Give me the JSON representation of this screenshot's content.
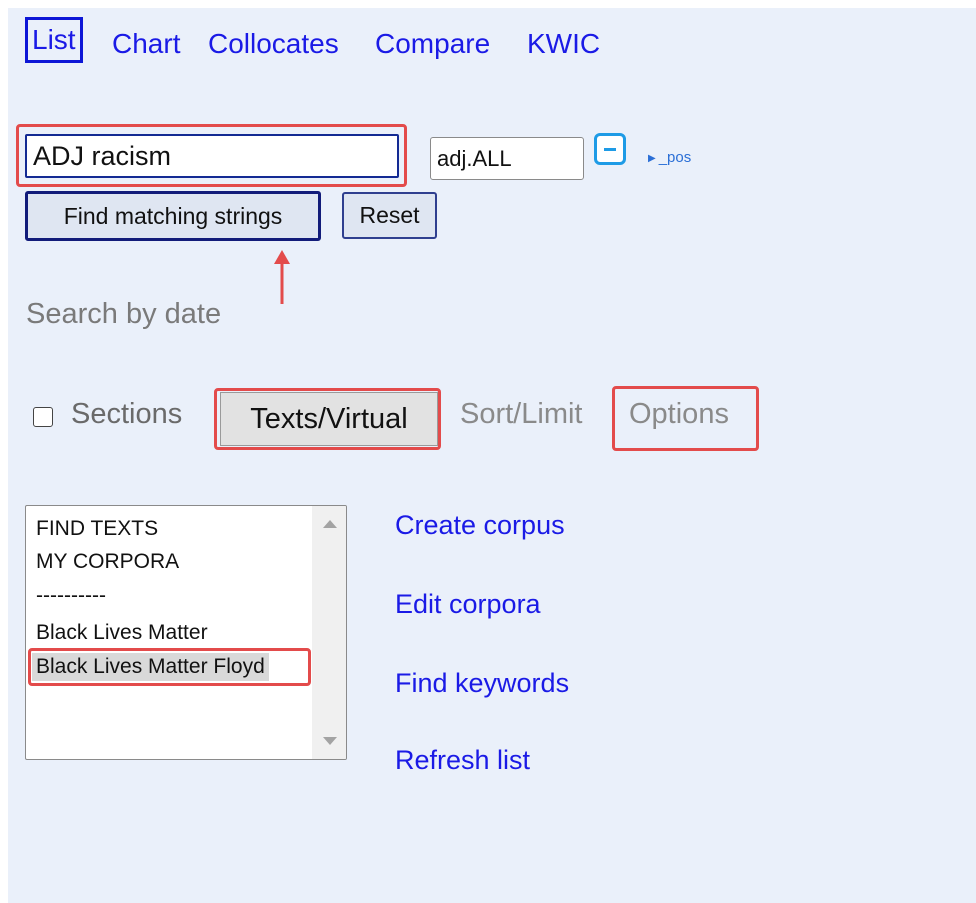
{
  "nav": {
    "tabs": [
      {
        "label": "List",
        "active": true
      },
      {
        "label": "Chart"
      },
      {
        "label": "Collocates"
      },
      {
        "label": "Compare"
      },
      {
        "label": "KWIC"
      }
    ]
  },
  "search": {
    "word_value": "ADJ racism",
    "pos_value": "adj.ALL",
    "pos_link": "_pos",
    "find_button": "Find matching strings",
    "reset_button": "Reset",
    "search_by_date": "Search by date"
  },
  "options_row": {
    "sections_label": "Sections",
    "sections_checked": false,
    "texts_virtual": "Texts/Virtual",
    "sort_limit": "Sort/Limit",
    "options": "Options"
  },
  "corpora_list": {
    "items": [
      "FIND TEXTS",
      "MY CORPORA",
      "----------",
      "Black Lives Matter",
      "Black Lives Matter Floyd"
    ],
    "selected_index": 4
  },
  "side_links": [
    "Create corpus",
    "Edit corpora",
    "Find keywords",
    "Refresh list"
  ],
  "colors": {
    "link": "#1a1ae6",
    "highlight": "#e34b4b",
    "background": "#eaf0fa"
  }
}
